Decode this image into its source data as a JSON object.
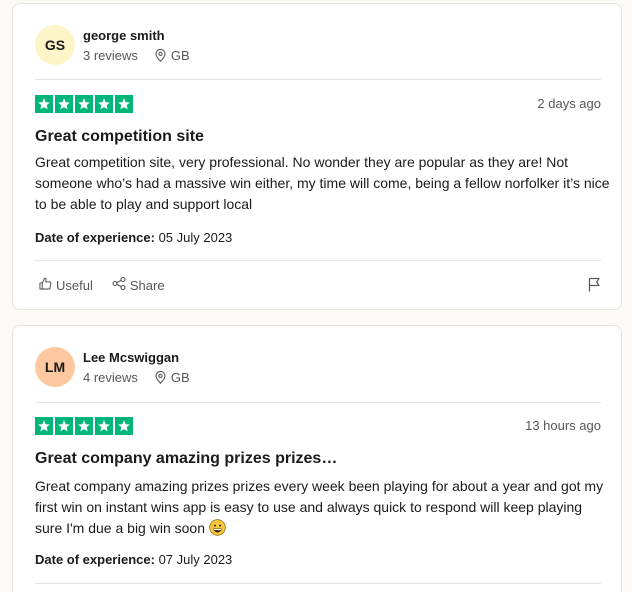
{
  "colors": {
    "star_green": "#00b67a",
    "avatar_1_bg": "#fdf5c8",
    "avatar_2_bg": "#fec9a1"
  },
  "reviews": [
    {
      "initials": "GS",
      "name": "george smith",
      "review_count": "3 reviews",
      "country": "GB",
      "rating": 5,
      "date_ago": "2 days ago",
      "title": "Great competition site",
      "body": "Great competition site, very professional. No wonder they are popular as they are! Not someone who’s had a massive win either, my time will come, being a fellow norfolker it’s nice to be able to play and support local",
      "experience_label": "Date of experience:",
      "experience_date": "05 July 2023",
      "useful_label": "Useful",
      "share_label": "Share"
    },
    {
      "initials": "LM",
      "name": "Lee Mcswiggan",
      "review_count": "4 reviews",
      "country": "GB",
      "rating": 5,
      "date_ago": "13 hours ago",
      "title": "Great company amazing prizes prizes…",
      "body": "Great company amazing prizes prizes every week been playing for about a year and got my first win on instant wins app is easy to use and always quick to respond will keep playing sure I'm due a big win soon",
      "experience_label": "Date of experience:",
      "experience_date": "07 July 2023"
    }
  ],
  "icons": {
    "location": "location-pin-icon",
    "star": "star-icon",
    "useful": "thumbs-up-icon",
    "share": "share-icon",
    "flag": "flag-icon",
    "emoji": "grinning-face-emoji-icon"
  }
}
